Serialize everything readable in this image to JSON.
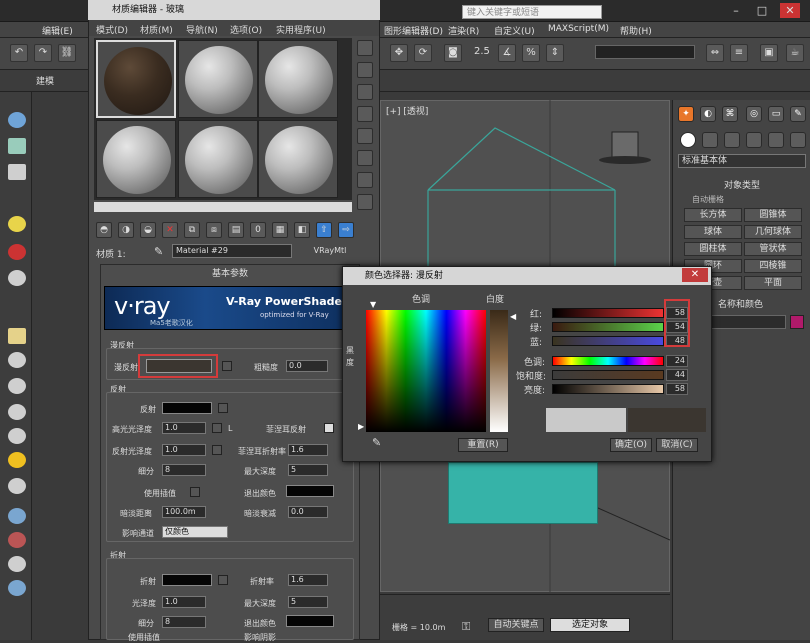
{
  "max_window": {
    "search_placeholder": "键入关键字或短语",
    "menus": [
      "编辑(E)",
      "图形编辑器(D)",
      "渲染(R)",
      "自定义(U)",
      "MAXScript(M)",
      "帮助(H)"
    ],
    "ribbon_label": "建模",
    "toolbar_numbers": "2.5"
  },
  "viewport": {
    "label": "[+] [透视]"
  },
  "command_panel": {
    "dropdown": "标准基本体",
    "object_type_header": "对象类型",
    "autogrid": "自动栅格",
    "buttons": [
      "长方体",
      "圆锥体",
      "球体",
      "几何球体",
      "圆柱体",
      "管状体",
      "圆环",
      "四棱锥",
      "茶壶",
      "平面"
    ],
    "name_color_header": "名称和颜色"
  },
  "material_editor": {
    "title": "材质编辑器 - 玻璃",
    "menus": [
      "模式(D)",
      "材质(M)",
      "导航(N)",
      "选项(O)",
      "实用程序(U)"
    ],
    "material_label": "材质 1:",
    "material_name": "Material #29",
    "material_type": "VRayMtl",
    "rollout_title": "基本参数",
    "vray_logo": "v·ray",
    "vray_sub": "Ma5老歌汉化",
    "vray_title": "V-Ray PowerShader",
    "vray_tagline": "optimized for V-Ray",
    "diffuse_group": "漫反射",
    "diffuse_label": "漫反射",
    "roughness_label": "粗糙度",
    "roughness_value": "0.0",
    "reflect_group": "反射",
    "reflect_rows": [
      {
        "label": "反射"
      },
      {
        "label": "高光光泽度",
        "value": "1.0",
        "extra": "L",
        "right_label": "菲涅耳反射"
      },
      {
        "label": "反射光泽度",
        "value": "1.0",
        "right_label": "菲涅耳折射率",
        "right_value": "1.6"
      },
      {
        "label": "细分",
        "value": "8",
        "right_label": "最大深度",
        "right_value": "5"
      },
      {
        "label": "使用插值",
        "right_label": "退出颜色"
      },
      {
        "label": "暗淡距离",
        "value": "100.0m",
        "right_label": "暗淡衰减",
        "right_value": "0.0"
      },
      {
        "label": "影响通道",
        "dropdown": "仅颜色"
      }
    ],
    "refract_group": "折射",
    "refract_rows": [
      {
        "label": "折射",
        "right_label": "折射率",
        "right_value": "1.6"
      },
      {
        "label": "光泽度",
        "value": "1.0",
        "right_label": "最大深度",
        "right_value": "5"
      },
      {
        "label": "细分",
        "value": "8",
        "right_label": "退出颜色"
      },
      {
        "label": "使用插值",
        "right_label": "影响阴影"
      }
    ]
  },
  "color_dialog": {
    "title": "颜色选择器: 漫反射",
    "hue_label": "色调",
    "whiteness_label": "白度",
    "blackness_label": "黑度",
    "rows": [
      {
        "label": "红:",
        "value": "58"
      },
      {
        "label": "绿:",
        "value": "54"
      },
      {
        "label": "蓝:",
        "value": "48"
      },
      {
        "label": "色调:",
        "value": "24"
      },
      {
        "label": "饱和度:",
        "value": "44"
      },
      {
        "label": "亮度:",
        "value": "58"
      }
    ],
    "reset_button": "重置(R)",
    "ok_button": "确定(O)",
    "cancel_button": "取消(C)",
    "colors": {
      "old": "#c9c9c9",
      "new": "#3b3630"
    }
  },
  "status": {
    "grid": "栅格 = 10.0m",
    "auto_key": "自动关键点",
    "selected": "选定对象"
  }
}
